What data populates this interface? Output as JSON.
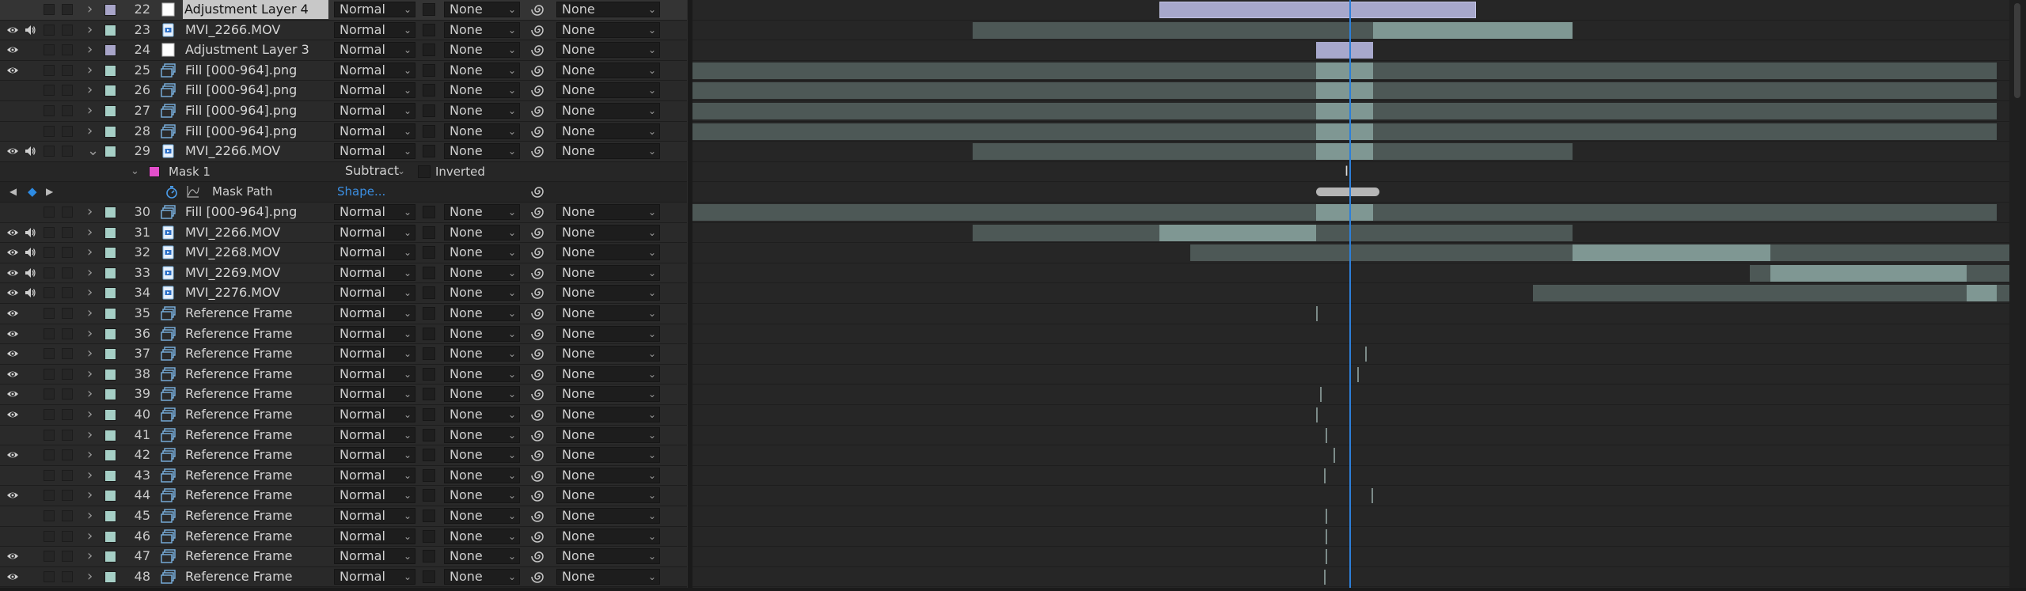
{
  "colors": {
    "accent": "#2d7fd9",
    "bar_clip": "#4d5856",
    "bar_clip_light": "#7f9793",
    "bar_dark": "#3e4847",
    "bar_adjust": "#a7a8cc",
    "label_aqua": "#a6cfc6",
    "label_lavender": "#a8a5c9",
    "label_pink": "#e34fcb",
    "label_white": "#ffffff"
  },
  "layers": [
    {
      "num": "22",
      "name": "Adjustment Layer 4",
      "mode": "Normal",
      "track": "None",
      "parent": "None",
      "eye": false,
      "audio": false,
      "label": "#a8a5c9",
      "src": "adjust",
      "selected": true
    },
    {
      "num": "23",
      "name": "MVI_2266.MOV",
      "mode": "Normal",
      "track": "None",
      "parent": "None",
      "eye": true,
      "audio": true,
      "label": "#a6cfc6",
      "src": "video"
    },
    {
      "num": "24",
      "name": "Adjustment Layer 3",
      "mode": "Normal",
      "track": "None",
      "parent": "None",
      "eye": true,
      "audio": false,
      "label": "#a8a5c9",
      "src": "adjust"
    },
    {
      "num": "25",
      "name": "Fill  [000-964].png",
      "mode": "Normal",
      "track": "None",
      "parent": "None",
      "eye": true,
      "audio": false,
      "label": "#a6cfc6",
      "src": "seq"
    },
    {
      "num": "26",
      "name": "Fill  [000-964].png",
      "mode": "Normal",
      "track": "None",
      "parent": "None",
      "eye": false,
      "audio": false,
      "label": "#a6cfc6",
      "src": "seq"
    },
    {
      "num": "27",
      "name": "Fill  [000-964].png",
      "mode": "Normal",
      "track": "None",
      "parent": "None",
      "eye": false,
      "audio": false,
      "label": "#a6cfc6",
      "src": "seq"
    },
    {
      "num": "28",
      "name": "Fill  [000-964].png",
      "mode": "Normal",
      "track": "None",
      "parent": "None",
      "eye": false,
      "audio": false,
      "label": "#a6cfc6",
      "src": "seq"
    },
    {
      "num": "29",
      "name": "MVI_2266.MOV",
      "mode": "Normal",
      "track": "None",
      "parent": "None",
      "eye": true,
      "audio": true,
      "label": "#a6cfc6",
      "src": "video",
      "expanded": true
    },
    {
      "type": "mask",
      "name": "Mask 1",
      "mode": "Subtract",
      "inverted": "Inverted",
      "label": "#e34fcb"
    },
    {
      "type": "maskpath",
      "name": "Mask Path",
      "value": "Shape..."
    },
    {
      "num": "30",
      "name": "Fill  [000-964].png",
      "mode": "Normal",
      "track": "None",
      "parent": "None",
      "eye": false,
      "audio": false,
      "label": "#a6cfc6",
      "src": "seq"
    },
    {
      "num": "31",
      "name": "MVI_2266.MOV",
      "mode": "Normal",
      "track": "None",
      "parent": "None",
      "eye": true,
      "audio": true,
      "label": "#a6cfc6",
      "src": "video"
    },
    {
      "num": "32",
      "name": "MVI_2268.MOV",
      "mode": "Normal",
      "track": "None",
      "parent": "None",
      "eye": true,
      "audio": true,
      "label": "#a6cfc6",
      "src": "video"
    },
    {
      "num": "33",
      "name": "MVI_2269.MOV",
      "mode": "Normal",
      "track": "None",
      "parent": "None",
      "eye": true,
      "audio": true,
      "label": "#a6cfc6",
      "src": "video"
    },
    {
      "num": "34",
      "name": "MVI_2276.MOV",
      "mode": "Normal",
      "track": "None",
      "parent": "None",
      "eye": true,
      "audio": true,
      "label": "#a6cfc6",
      "src": "video"
    },
    {
      "num": "35",
      "name": "Reference Frame",
      "mode": "Normal",
      "track": "None",
      "parent": "None",
      "eye": true,
      "audio": false,
      "label": "#a6cfc6",
      "src": "seq"
    },
    {
      "num": "36",
      "name": "Reference Frame",
      "mode": "Normal",
      "track": "None",
      "parent": "None",
      "eye": true,
      "audio": false,
      "label": "#a6cfc6",
      "src": "seq"
    },
    {
      "num": "37",
      "name": "Reference Frame",
      "mode": "Normal",
      "track": "None",
      "parent": "None",
      "eye": true,
      "audio": false,
      "label": "#a6cfc6",
      "src": "seq"
    },
    {
      "num": "38",
      "name": "Reference Frame",
      "mode": "Normal",
      "track": "None",
      "parent": "None",
      "eye": true,
      "audio": false,
      "label": "#a6cfc6",
      "src": "seq"
    },
    {
      "num": "39",
      "name": "Reference Frame",
      "mode": "Normal",
      "track": "None",
      "parent": "None",
      "eye": true,
      "audio": false,
      "label": "#a6cfc6",
      "src": "seq"
    },
    {
      "num": "40",
      "name": "Reference Frame",
      "mode": "Normal",
      "track": "None",
      "parent": "None",
      "eye": true,
      "audio": false,
      "label": "#a6cfc6",
      "src": "seq"
    },
    {
      "num": "41",
      "name": "Reference Frame",
      "mode": "Normal",
      "track": "None",
      "parent": "None",
      "eye": false,
      "audio": false,
      "label": "#a6cfc6",
      "src": "seq"
    },
    {
      "num": "42",
      "name": "Reference Frame",
      "mode": "Normal",
      "track": "None",
      "parent": "None",
      "eye": true,
      "audio": false,
      "label": "#a6cfc6",
      "src": "seq"
    },
    {
      "num": "43",
      "name": "Reference Frame",
      "mode": "Normal",
      "track": "None",
      "parent": "None",
      "eye": false,
      "audio": false,
      "label": "#a6cfc6",
      "src": "seq"
    },
    {
      "num": "44",
      "name": "Reference Frame",
      "mode": "Normal",
      "track": "None",
      "parent": "None",
      "eye": true,
      "audio": false,
      "label": "#a6cfc6",
      "src": "seq"
    },
    {
      "num": "45",
      "name": "Reference Frame",
      "mode": "Normal",
      "track": "None",
      "parent": "None",
      "eye": false,
      "audio": false,
      "label": "#a6cfc6",
      "src": "seq"
    },
    {
      "num": "46",
      "name": "Reference Frame",
      "mode": "Normal",
      "track": "None",
      "parent": "None",
      "eye": false,
      "audio": false,
      "label": "#a6cfc6",
      "src": "seq"
    },
    {
      "num": "47",
      "name": "Reference Frame",
      "mode": "Normal",
      "track": "None",
      "parent": "None",
      "eye": true,
      "audio": false,
      "label": "#a6cfc6",
      "src": "seq"
    },
    {
      "num": "48",
      "name": "Reference Frame",
      "mode": "Normal",
      "track": "None",
      "parent": "None",
      "eye": true,
      "audio": false,
      "label": "#a6cfc6",
      "src": "seq"
    }
  ],
  "icons": {
    "eye": "eye-icon",
    "audio": "speaker-icon",
    "twirl": "chevron-right-icon",
    "stopwatch": "stopwatch-icon",
    "graph": "graph-icon",
    "pickwhip": "pickwhip-icon",
    "keyframe_nav": "keyframe-navigator-icon"
  }
}
